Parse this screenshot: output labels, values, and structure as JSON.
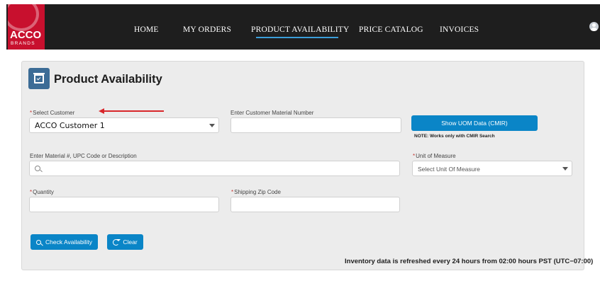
{
  "header": {
    "logo_text": "ACCO",
    "logo_subtext": "BRANDS",
    "nav": [
      {
        "label": "HOME",
        "active": false
      },
      {
        "label": "MY ORDERS",
        "active": false
      },
      {
        "label": "PRODUCT AVAILABILITY",
        "active": true
      },
      {
        "label": "PRICE CATALOG",
        "active": false
      },
      {
        "label": "INVOICES",
        "active": false
      }
    ],
    "user_icon": "user-avatar-icon"
  },
  "page": {
    "title": "Product Availability",
    "title_icon": "product-box-check-icon"
  },
  "form": {
    "required_marker": "*",
    "customer": {
      "label": "Select Customer",
      "value": "ACCO Customer 1",
      "required": true
    },
    "customer_material": {
      "label": "Enter Customer Material Number",
      "value": ""
    },
    "uom_button": {
      "label": "Show UOM Data (CMIR)",
      "note": "NOTE: Works only with CMIR Search"
    },
    "material_search": {
      "label": "Enter Material #, UPC Code or Description",
      "value": ""
    },
    "unit_of_measure": {
      "label": "Unit of Measure",
      "placeholder": "Select Unit Of Measure",
      "required": true
    },
    "quantity": {
      "label": "Quantity",
      "value": "",
      "required": true
    },
    "zip": {
      "label": "Shipping Zip Code",
      "value": "",
      "required": true
    }
  },
  "actions": {
    "check_label": "Check Availability",
    "clear_label": "Clear"
  },
  "footer": {
    "info": "Inventory data is refreshed every 24 hours from 02:00 hours PST (UTC−07:00)"
  },
  "colors": {
    "accent": "#0a85c7",
    "brand_red": "#c8102e",
    "nav_bg": "#1e1e1e",
    "required": "#c23934",
    "annotation_arrow": "#d8262a"
  }
}
